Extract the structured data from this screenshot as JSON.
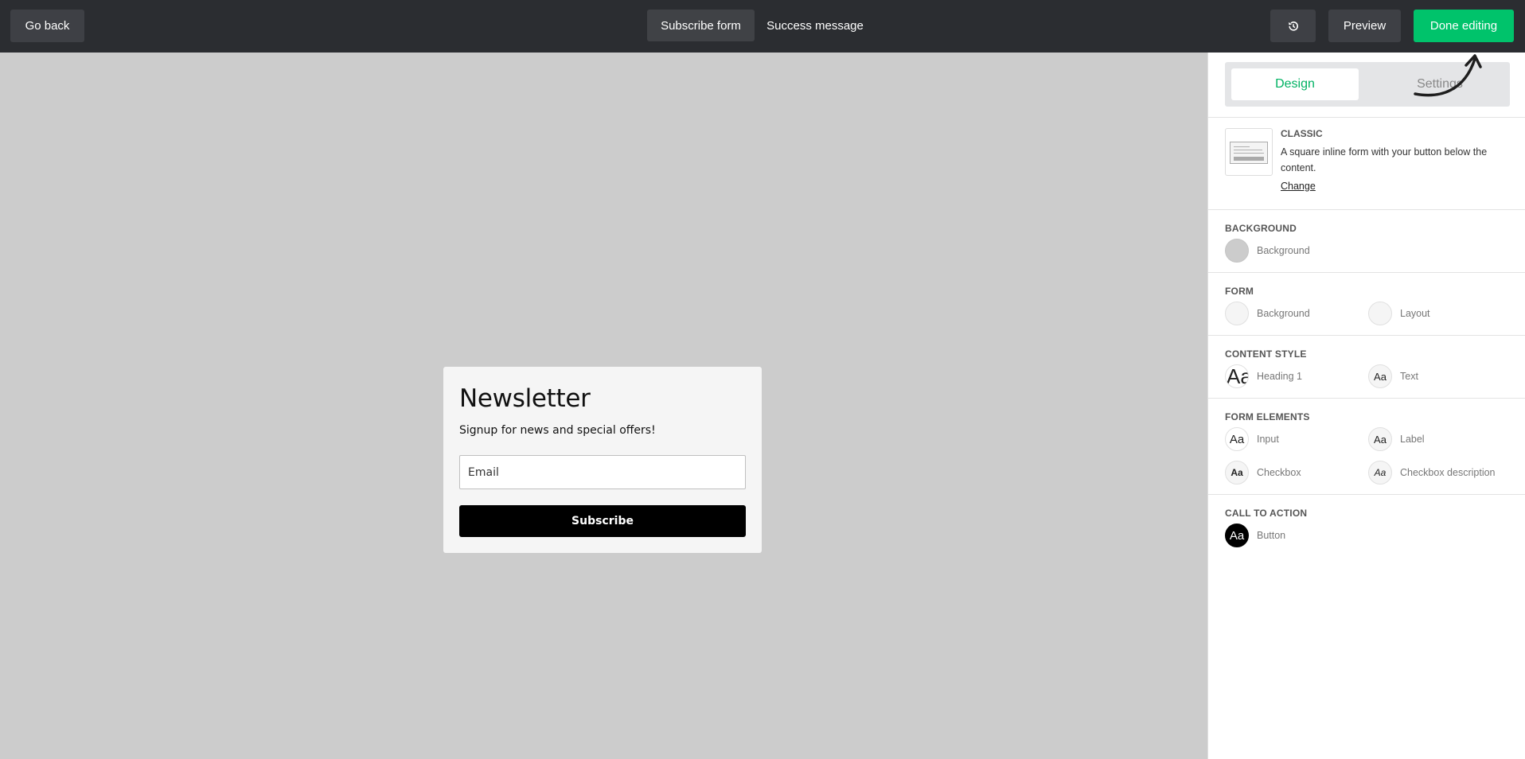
{
  "topbar": {
    "go_back": "Go back",
    "tabs": [
      {
        "label": "Subscribe form"
      },
      {
        "label": "Success message"
      }
    ],
    "preview": "Preview",
    "done": "Done editing",
    "history_icon": "history-icon"
  },
  "form": {
    "title": "Newsletter",
    "subtitle": "Signup for news and special offers!",
    "email_placeholder": "Email",
    "button": "Subscribe"
  },
  "panel": {
    "tabs": {
      "design": "Design",
      "settings": "Settings"
    },
    "template": {
      "title": "CLASSIC",
      "description": "A square inline form with your button below the content.",
      "change": "Change"
    },
    "background": {
      "title": "BACKGROUND",
      "options": [
        {
          "label": "Background",
          "swatch_color": "#cccccc"
        }
      ]
    },
    "form_section": {
      "title": "FORM",
      "options": [
        {
          "label": "Background",
          "swatch_color": "#f5f5f5"
        },
        {
          "label": "Layout",
          "swatch_color": "#f5f5f5"
        }
      ]
    },
    "content_style": {
      "title": "CONTENT STYLE",
      "options": [
        {
          "label": "Heading 1",
          "glyph": "Aa"
        },
        {
          "label": "Text",
          "glyph": "Aa"
        }
      ]
    },
    "form_elements": {
      "title": "FORM ELEMENTS",
      "options": [
        {
          "label": "Input",
          "glyph": "Aa"
        },
        {
          "label": "Label",
          "glyph": "Aa"
        },
        {
          "label": "Checkbox",
          "glyph": "Aa"
        },
        {
          "label": "Checkbox description",
          "glyph": "Aa"
        }
      ]
    },
    "call_to_action": {
      "title": "CALL TO ACTION",
      "options": [
        {
          "label": "Button",
          "glyph": "Aa",
          "swatch_color": "#000000"
        }
      ]
    }
  },
  "colors": {
    "topbar": "#2b2d31",
    "accent": "#00c36b",
    "canvas": "#cccccc"
  }
}
